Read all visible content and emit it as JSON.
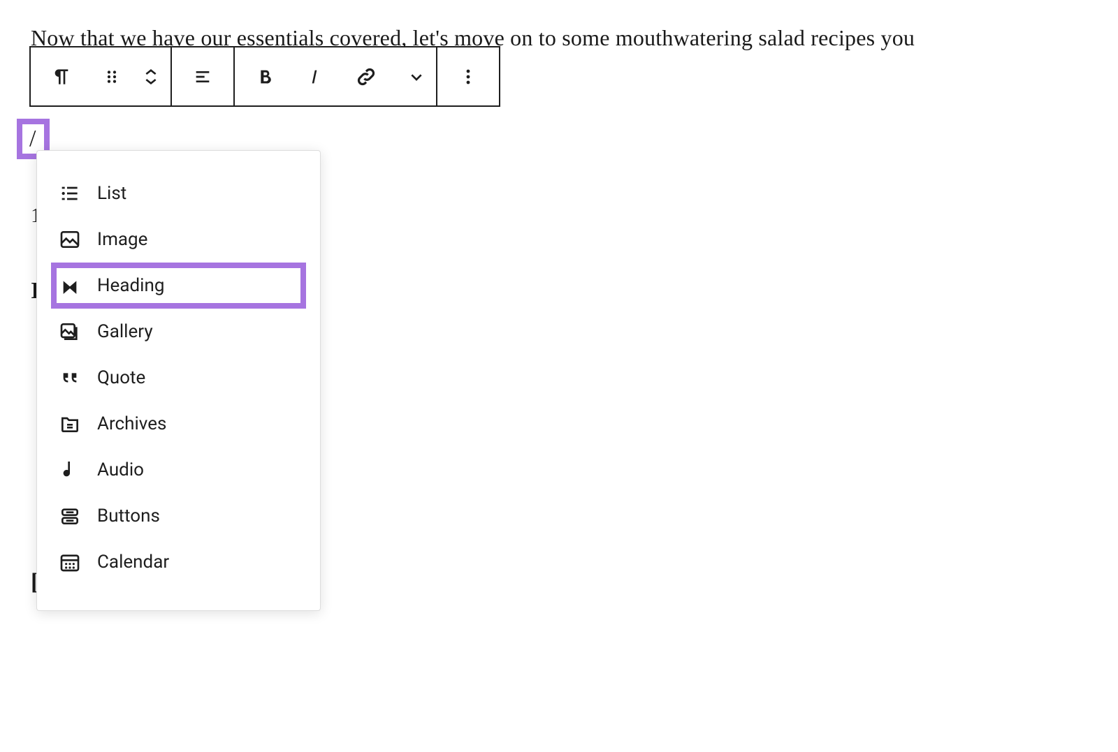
{
  "content": {
    "paragraph": "Now that we have our essentials covered, let's move on to some mouthwatering salad recipes you"
  },
  "toolbar": {
    "paragraph_icon": "paragraph-icon",
    "drag_icon": "drag-handle-icon",
    "move_icon": "move-up-down-icon",
    "align_icon": "align-icon",
    "bold_icon": "bold-icon",
    "italic_icon": "italic-icon",
    "link_icon": "link-icon",
    "chevron_icon": "chevron-down-icon",
    "more_icon": "more-vertical-icon"
  },
  "slash": {
    "value": "/"
  },
  "background": {
    "char1": "1",
    "char2": "I",
    "char3": "["
  },
  "dropdown": {
    "items": [
      {
        "icon": "list-icon",
        "label": "List",
        "highlighted": false
      },
      {
        "icon": "image-icon",
        "label": "Image",
        "highlighted": false
      },
      {
        "icon": "heading-icon",
        "label": "Heading",
        "highlighted": true
      },
      {
        "icon": "gallery-icon",
        "label": "Gallery",
        "highlighted": false
      },
      {
        "icon": "quote-icon",
        "label": "Quote",
        "highlighted": false
      },
      {
        "icon": "archives-icon",
        "label": "Archives",
        "highlighted": false
      },
      {
        "icon": "audio-icon",
        "label": "Audio",
        "highlighted": false
      },
      {
        "icon": "buttons-icon",
        "label": "Buttons",
        "highlighted": false
      },
      {
        "icon": "calendar-icon",
        "label": "Calendar",
        "highlighted": false
      }
    ]
  },
  "colors": {
    "highlight": "#a674e0"
  }
}
